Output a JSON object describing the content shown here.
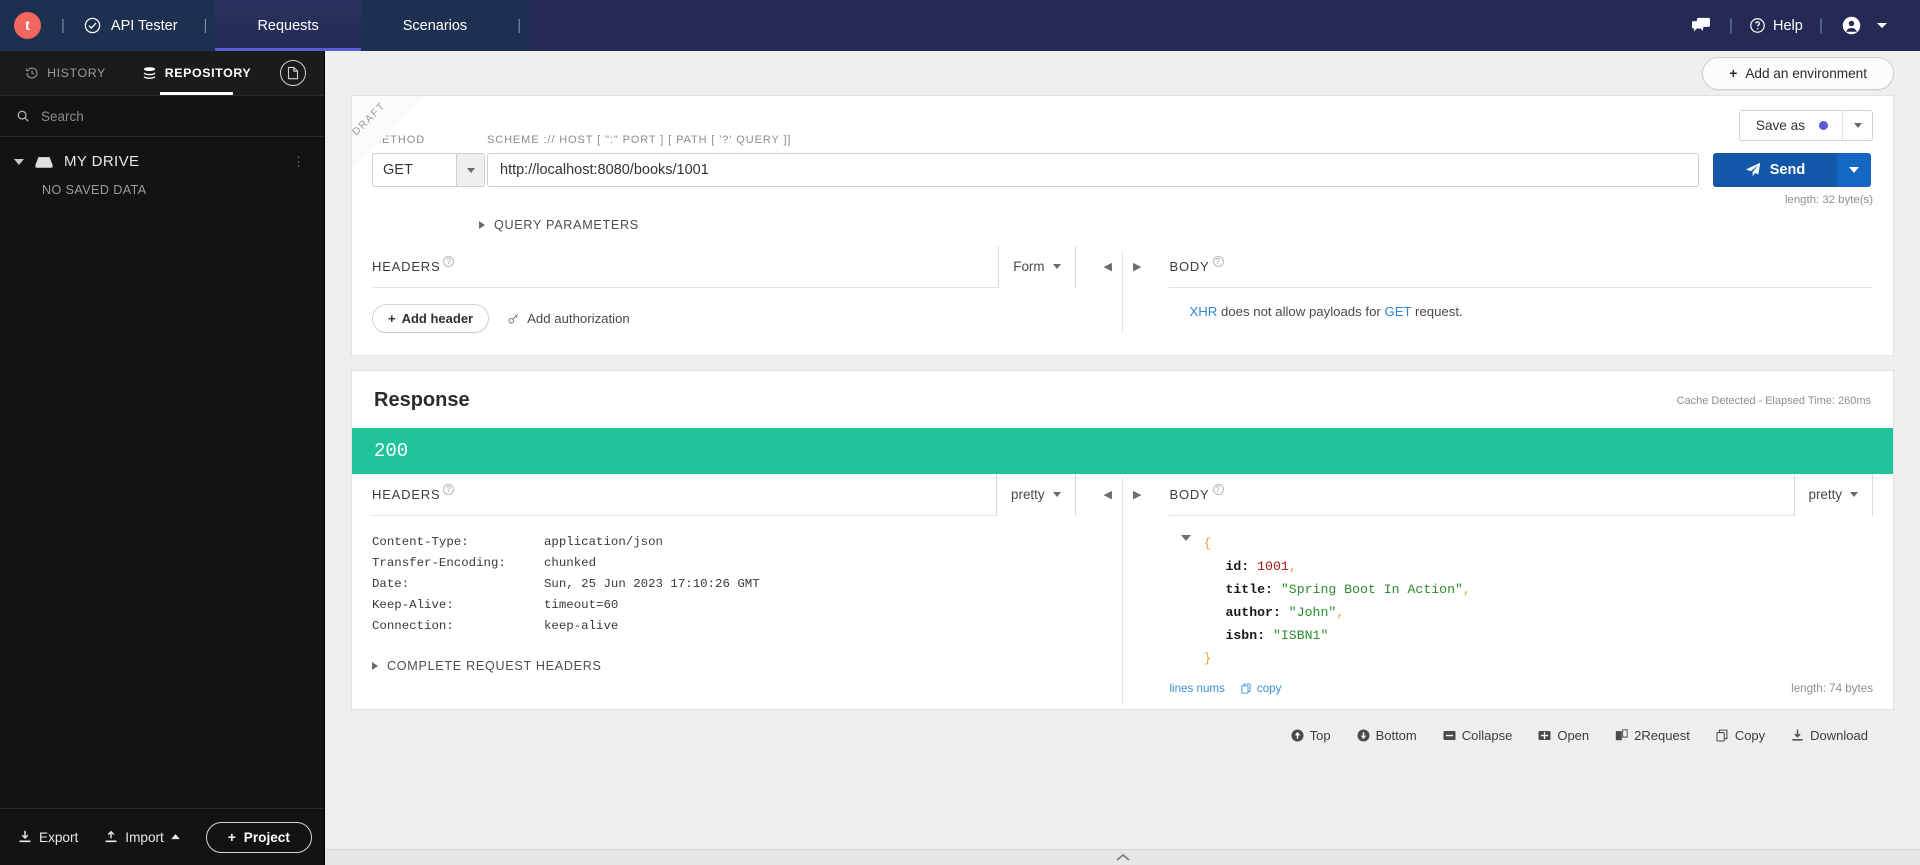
{
  "topnav": {
    "logo_letter": "t",
    "brand": "API Tester",
    "tabs": [
      {
        "label": "Requests",
        "active": true
      },
      {
        "label": "Scenarios",
        "active": false
      }
    ],
    "chat_icon": "chat-bubbles-icon",
    "help_label": "Help",
    "account_icon": "user-avatar-icon"
  },
  "sidebar": {
    "tabs": [
      {
        "label": "HISTORY",
        "icon": "clock-history-icon",
        "active": false
      },
      {
        "label": "REPOSITORY",
        "icon": "database-stack-icon",
        "active": true
      }
    ],
    "doc_tab_icon": "document-icon",
    "search_placeholder": "Search",
    "search_value": "",
    "drive": {
      "label": "MY DRIVE",
      "icon": "drive-icon",
      "empty_text": "NO SAVED DATA"
    },
    "footer": {
      "export_label": "Export",
      "import_label": "Import",
      "project_label": "Project"
    }
  },
  "main": {
    "add_environment_label": "Add an environment",
    "request": {
      "draft_ribbon": "DRAFT",
      "method_label": "METHOD",
      "method_value": "GET",
      "url_label": "SCHEME :// HOST [ \":\" PORT ] [ PATH [ '?' QUERY ]]",
      "url_value": "http://localhost:8080/books/1001",
      "url_placeholder": "http://localhost:8080/books/1001",
      "save_as_label": "Save as",
      "send_label": "Send",
      "length_note": "length: 32 byte(s)",
      "query_parameters_label": "QUERY PARAMETERS",
      "headers_panel": {
        "title": "HEADERS",
        "format_value": "Form",
        "add_header_label": "Add header",
        "add_authorization_label": "Add authorization"
      },
      "body_panel": {
        "title": "BODY",
        "note_prefix": "XHR",
        "note_middle": " does not allow payloads for ",
        "note_method": "GET",
        "note_suffix": " request."
      }
    },
    "response": {
      "title": "Response",
      "meta": "Cache Detected - Elapsed Time: 260ms",
      "status_code": "200",
      "headers_panel": {
        "title": "HEADERS",
        "format_value": "pretty",
        "rows": [
          {
            "key": "Content-Type:",
            "value": "application/json"
          },
          {
            "key": "Transfer-Encoding:",
            "value": "chunked"
          },
          {
            "key": "Date:",
            "value": "Sun, 25 Jun 2023 17:10:26 GMT"
          },
          {
            "key": "Keep-Alive:",
            "value": "timeout=60"
          },
          {
            "key": "Connection:",
            "value": "keep-alive"
          }
        ],
        "complete_request_headers_label": "COMPLETE REQUEST HEADERS"
      },
      "body_panel": {
        "title": "BODY",
        "format_value": "pretty",
        "json": {
          "open_brace": "{",
          "close_brace": "}",
          "fields": [
            {
              "key": "id:",
              "value": "1001",
              "type": "number",
              "comma": ","
            },
            {
              "key": "title:",
              "value": "\"Spring Boot In Action\"",
              "type": "string",
              "comma": ","
            },
            {
              "key": "author:",
              "value": "\"John\"",
              "type": "string",
              "comma": ","
            },
            {
              "key": "isbn:",
              "value": "\"ISBN1\"",
              "type": "string",
              "comma": ""
            }
          ]
        },
        "lines_nums_label": "lines nums",
        "copy_label": "copy",
        "length_label": "length: 74 bytes"
      }
    },
    "bottom_tools": [
      {
        "label": "Top",
        "icon": "arrow-up-circle-icon"
      },
      {
        "label": "Bottom",
        "icon": "arrow-down-circle-icon"
      },
      {
        "label": "Collapse",
        "icon": "minus-square-icon"
      },
      {
        "label": "Open",
        "icon": "plus-square-icon"
      },
      {
        "label": "2Request",
        "icon": "copy-to-request-icon"
      },
      {
        "label": "Copy",
        "icon": "copy-icon"
      },
      {
        "label": "Download",
        "icon": "download-icon"
      }
    ]
  },
  "colors": {
    "nav_bg": "#252a54",
    "nav_tab_bg": "#1e3050",
    "accent_tab": "#5b5bd6",
    "logo": "#f2665e",
    "send_blue": "#1257a8",
    "status_green": "#21c39b",
    "link_blue": "#2f86d6"
  }
}
